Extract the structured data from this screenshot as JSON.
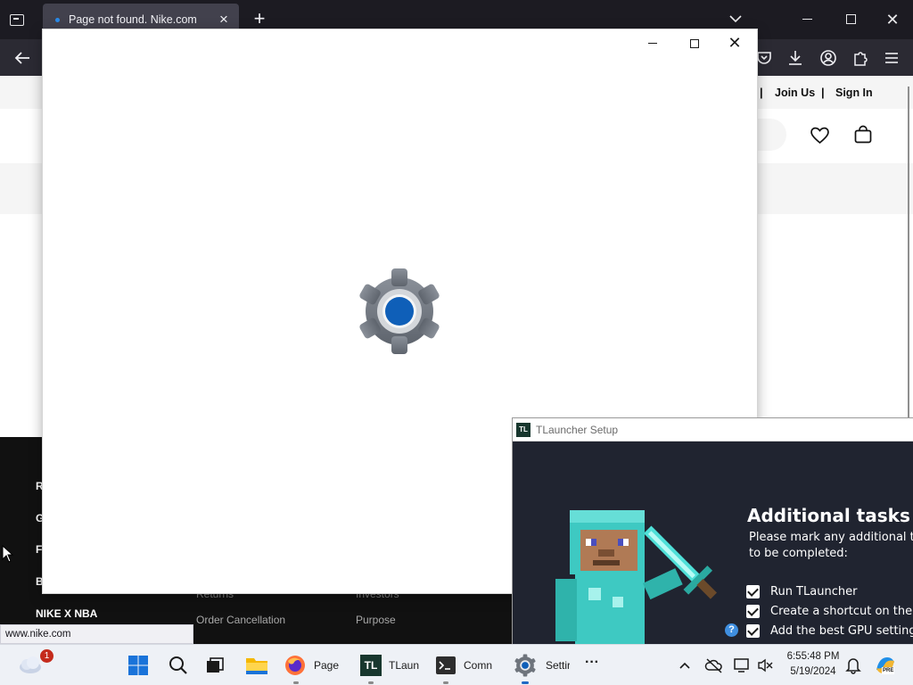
{
  "browser": {
    "tab": {
      "title": "Page not found. Nike.com",
      "close": "×"
    },
    "new_tab": "+",
    "window_close": "✕"
  },
  "status_bar": {
    "url": "www.nike.com"
  },
  "nike": {
    "topbar": {
      "separator": "|",
      "join_us": "Join Us",
      "sign_in": "Sign In"
    },
    "footer": {
      "letters": [
        "R",
        "G",
        "F",
        "B"
      ],
      "nike_x_nba": "NIKE X NBA",
      "cut_links": [
        "Returns",
        "Investors"
      ],
      "links": [
        "Order Cancellation",
        "Purpose"
      ]
    }
  },
  "settings_window": {
    "close": "✕",
    "icon": "settings-gear-icon"
  },
  "tlauncher": {
    "window_title": "TLauncher Setup",
    "icon_text": "TL",
    "heading": "Additional tasks",
    "description": "Please mark any additional ta to be completed:",
    "tasks": [
      {
        "label": "Run TLauncher",
        "checked": true
      },
      {
        "label": "Create a shortcut on the d",
        "checked": true
      },
      {
        "label": "Add the best GPU settings",
        "checked": true
      }
    ],
    "help": "?"
  },
  "taskbar": {
    "weather_badge": "1",
    "apps": [
      {
        "name": "firefox",
        "label": "Page r"
      },
      {
        "name": "tlauncher",
        "label": "TLaun",
        "icon_text": "TL"
      },
      {
        "name": "command-prompt",
        "label": "Comn"
      },
      {
        "name": "settings",
        "label": "Settir"
      }
    ],
    "more": "···",
    "clock": {
      "time": "6:55:48 PM",
      "date": "5/19/2024"
    },
    "copilot_badge": "PRE"
  },
  "colors": {
    "browser_tabbar": "#1c1b22",
    "browser_toolbar": "#2b2a33",
    "tlauncher_bg": "#202430",
    "gear_accent": "#0f5fb8",
    "taskbar": "#eef1f6"
  }
}
